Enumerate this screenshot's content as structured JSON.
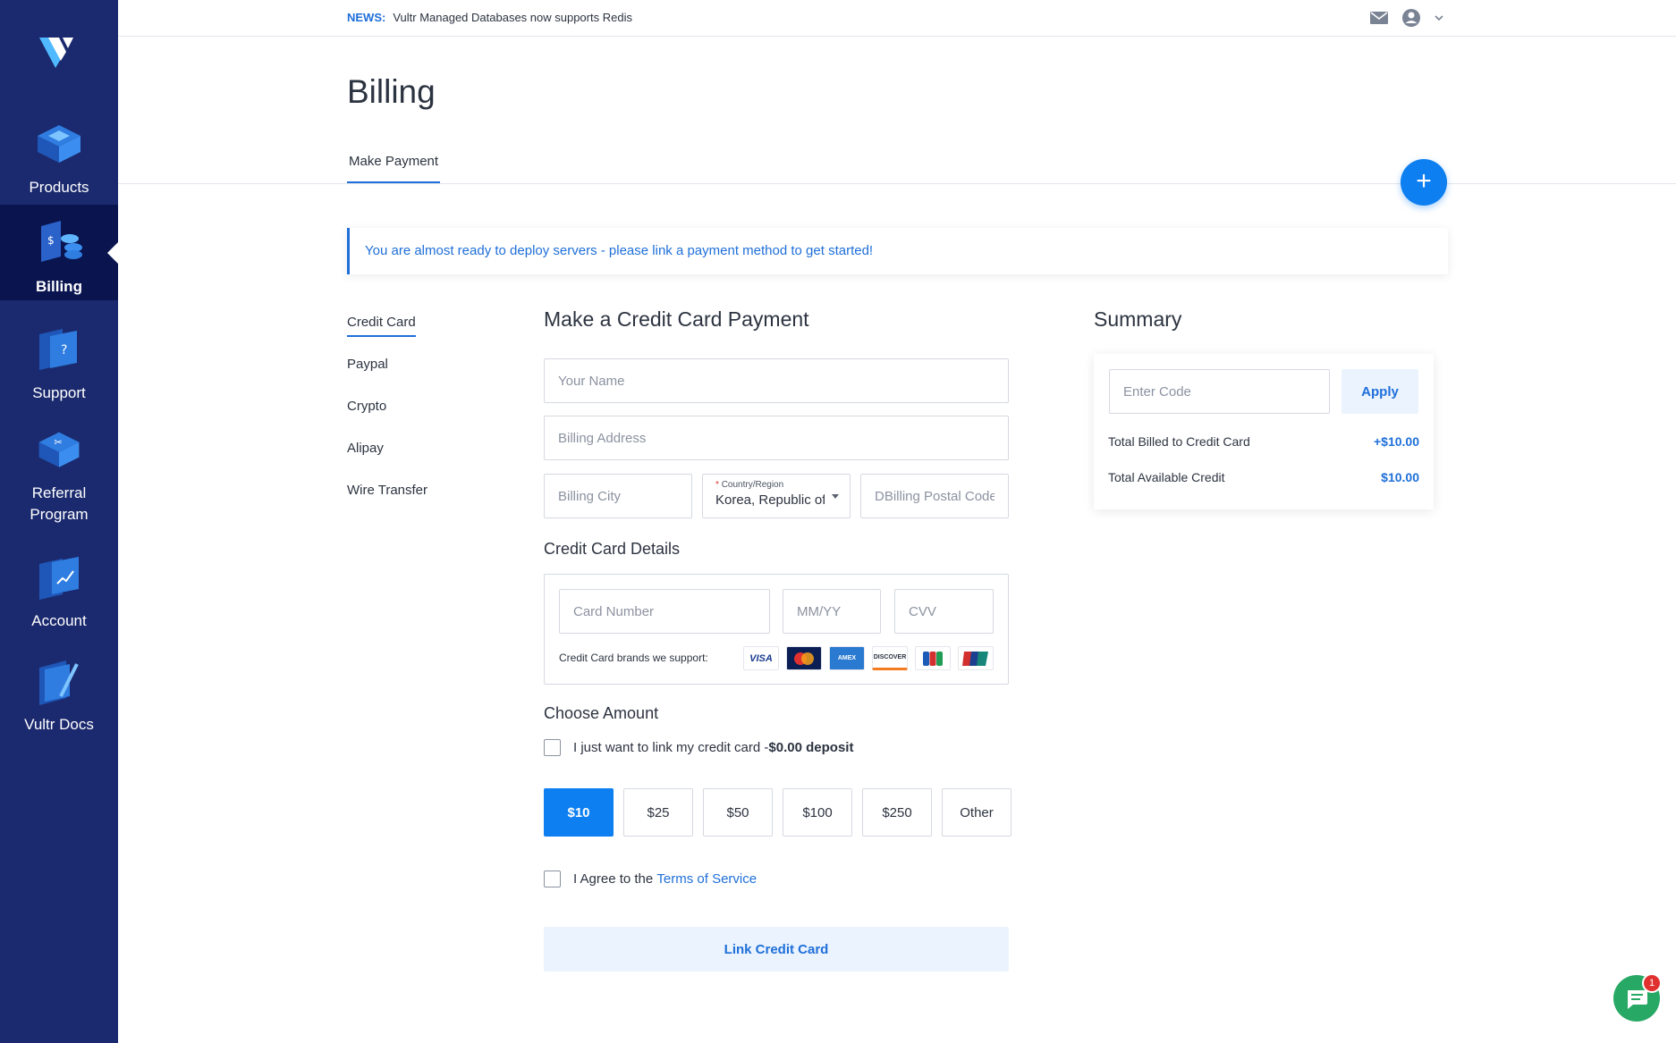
{
  "sidebar": {
    "items": [
      {
        "label": "Products"
      },
      {
        "label": "Billing"
      },
      {
        "label": "Support"
      },
      {
        "label": "Referral Program"
      },
      {
        "label": "Account"
      },
      {
        "label": "Vultr Docs"
      }
    ],
    "active_index": 1
  },
  "topbar": {
    "news_tag": "NEWS:",
    "news_text": "Vultr Managed Databases now supports Redis"
  },
  "page": {
    "title": "Billing",
    "tab": "Make Payment"
  },
  "alert": {
    "text": "You are almost ready to deploy servers - please link a payment method to get started!"
  },
  "methods": [
    "Credit Card",
    "Paypal",
    "Crypto",
    "Alipay",
    "Wire Transfer"
  ],
  "form": {
    "title": "Make a Credit Card Payment",
    "name_placeholder": "Your Name",
    "address_placeholder": "Billing Address",
    "city_placeholder": "Billing City",
    "country_label_required": "*",
    "country_label": "Country/Region",
    "country_value": "Korea, Republic of",
    "postal_placeholder": "DBilling Postal Code",
    "cc_title": "Credit Card Details",
    "card_placeholder": "Card Number",
    "expiry_placeholder": "MM/YY",
    "cvv_placeholder": "CVV",
    "brands_label": "Credit Card brands we support:",
    "brands": [
      "VISA",
      "MasterCard",
      "AMEX",
      "DISCOVER",
      "JCB",
      "UnionPay"
    ],
    "amount_title": "Choose Amount",
    "link_only_text": "I just want to link my credit card -",
    "link_only_bold": "$0.00 deposit",
    "amounts": [
      "$10",
      "$25",
      "$50",
      "$100",
      "$250",
      "Other"
    ],
    "selected_amount": "$10",
    "agree_text": "I Agree to the",
    "terms_link": "Terms of Service",
    "submit_label": "Link Credit Card"
  },
  "summary": {
    "title": "Summary",
    "code_placeholder": "Enter Code",
    "apply_label": "Apply",
    "rows": [
      {
        "label": "Total Billed to Credit Card",
        "value": "+$10.00"
      },
      {
        "label": "Total Available Credit",
        "value": "$10.00"
      }
    ]
  },
  "chat": {
    "badge": "1"
  },
  "colors": {
    "sidebar": "#1b2a6e",
    "sidebar_active": "#0a1550",
    "accent": "#0d7ff0",
    "link": "#1e6fd9",
    "chat": "#27a865"
  }
}
